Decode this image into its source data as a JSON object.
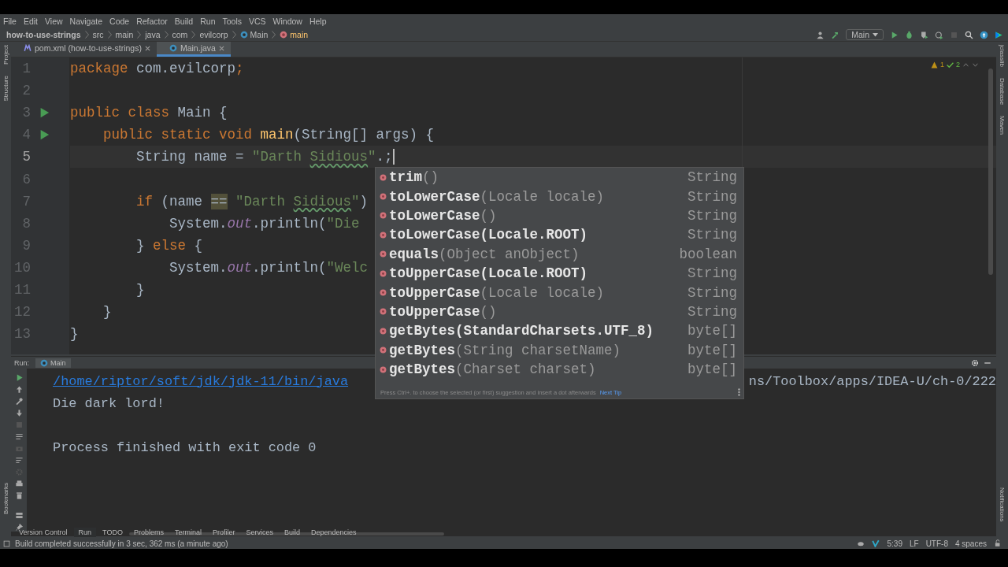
{
  "menu": [
    "File",
    "Edit",
    "View",
    "Navigate",
    "Code",
    "Refactor",
    "Build",
    "Run",
    "Tools",
    "VCS",
    "Window",
    "Help"
  ],
  "breadcrumb": [
    {
      "text": "how-to-use-strings",
      "kind": "project"
    },
    {
      "text": "src",
      "kind": "folder"
    },
    {
      "text": "main",
      "kind": "folder"
    },
    {
      "text": "java",
      "kind": "folder"
    },
    {
      "text": "com",
      "kind": "folder"
    },
    {
      "text": "evilcorp",
      "kind": "folder"
    },
    {
      "text": "Main",
      "kind": "class"
    },
    {
      "text": "main",
      "kind": "method"
    }
  ],
  "toolbar": {
    "run_config": "Main"
  },
  "tabs": [
    {
      "label": "pom.xml (how-to-use-strings)",
      "kind": "maven",
      "selected": false
    },
    {
      "label": "Main.java",
      "kind": "class",
      "selected": true
    }
  ],
  "left_strip": [
    "Project",
    "Structure",
    "Bookmarks"
  ],
  "right_strip": [
    "jclasslib",
    "Database",
    "Maven",
    "Notifications"
  ],
  "inspections": {
    "warnings": "1",
    "typos": "2"
  },
  "code_lines": [
    {
      "number": "1",
      "run_marker": false,
      "current": false,
      "tokens": [
        {
          "text": "package ",
          "kind": "kw"
        },
        {
          "text": "com.evilcorp",
          "kind": "plain"
        },
        {
          "text": ";",
          "kind": "kw"
        }
      ]
    },
    {
      "number": "2",
      "run_marker": false,
      "current": false
    },
    {
      "number": "3",
      "run_marker": true,
      "current": false,
      "tokens": [
        {
          "text": "public class ",
          "kind": "kw"
        },
        {
          "text": "Main {",
          "kind": "plain"
        }
      ]
    },
    {
      "number": "4",
      "run_marker": true,
      "current": false,
      "tokens": [
        {
          "text": "    public static void ",
          "kind": "kw"
        },
        {
          "text": "main",
          "kind": "method"
        },
        {
          "text": "(String[] args) {",
          "kind": "plain"
        }
      ]
    },
    {
      "number": "5",
      "run_marker": false,
      "current": true,
      "tokens": [
        {
          "text": "        String name = ",
          "kind": "plain"
        },
        {
          "text": "\"Darth ",
          "kind": "str"
        },
        {
          "text": "Sidious",
          "kind": "typo"
        },
        {
          "text": "\"",
          "kind": "str"
        },
        {
          "text": ".;",
          "kind": "plain"
        }
      ]
    },
    {
      "number": "6",
      "run_marker": false,
      "current": false
    },
    {
      "number": "7",
      "run_marker": false,
      "current": false,
      "tokens": [
        {
          "text": "        if ",
          "kind": "kw"
        },
        {
          "text": "(name ",
          "kind": "plain"
        },
        {
          "text": "==",
          "kind": "warn"
        },
        {
          "text": " \"Darth ",
          "kind": "str"
        },
        {
          "text": "Sidious",
          "kind": "typo"
        },
        {
          "text": "\"",
          "kind": "str"
        },
        {
          "text": ")",
          "kind": "plain"
        }
      ]
    },
    {
      "number": "8",
      "run_marker": false,
      "current": false,
      "tokens": [
        {
          "text": "            System.",
          "kind": "plain"
        },
        {
          "text": "out",
          "kind": "field"
        },
        {
          "text": ".println(",
          "kind": "plain"
        },
        {
          "text": "\"Die",
          "kind": "str"
        }
      ]
    },
    {
      "number": "9",
      "run_marker": false,
      "current": false,
      "tokens": [
        {
          "text": "        } ",
          "kind": "plain"
        },
        {
          "text": "else ",
          "kind": "kw"
        },
        {
          "text": "{",
          "kind": "plain"
        }
      ]
    },
    {
      "number": "10",
      "run_marker": false,
      "current": false,
      "tokens": [
        {
          "text": "            System.",
          "kind": "plain"
        },
        {
          "text": "out",
          "kind": "field"
        },
        {
          "text": ".println(",
          "kind": "plain"
        },
        {
          "text": "\"Welc",
          "kind": "str"
        }
      ]
    },
    {
      "number": "11",
      "run_marker": false,
      "current": false,
      "tokens": [
        {
          "text": "        }",
          "kind": "plain"
        }
      ]
    },
    {
      "number": "12",
      "run_marker": false,
      "current": false,
      "tokens": [
        {
          "text": "    }",
          "kind": "plain"
        }
      ]
    },
    {
      "number": "13",
      "run_marker": false,
      "current": false,
      "tokens": [
        {
          "text": "}",
          "kind": "plain"
        }
      ]
    }
  ],
  "completion": {
    "items": [
      {
        "name": "trim",
        "params": "()",
        "type": "String"
      },
      {
        "name": "toLowerCase",
        "params": "(Locale locale)",
        "type": "String"
      },
      {
        "name": "toLowerCase",
        "params": "()",
        "type": "String"
      },
      {
        "name": "toLowerCase(Locale.ROOT)",
        "type": "String"
      },
      {
        "name": "equals",
        "params": "(Object anObject)",
        "type": "boolean"
      },
      {
        "name": "toUpperCase(Locale.ROOT)",
        "type": "String"
      },
      {
        "name": "toUpperCase",
        "params": "(Locale locale)",
        "type": "String"
      },
      {
        "name": "toUpperCase",
        "params": "()",
        "type": "String"
      },
      {
        "name": "getBytes(StandardCharsets.UTF_8)",
        "type": "byte[]"
      },
      {
        "name": "getBytes",
        "params": "(String charsetName)",
        "type": "byte[]"
      },
      {
        "name": "getBytes",
        "params": "(Charset charset)",
        "type": "byte[]"
      }
    ],
    "hint": "Press Ctrl+. to choose the selected (or first) suggestion and insert a dot afterwards",
    "tip_link": "Next Tip"
  },
  "run_panel": {
    "label": "Run:",
    "tab": "Main",
    "output": [
      {
        "kind": "command",
        "text": "/home/riptor/soft/jdk/jdk-11/bin/java",
        "tail": "ns/Toolbox/apps/IDEA-U/ch-0/222"
      },
      {
        "kind": "text",
        "text": "Die dark lord!"
      },
      {
        "kind": "blank"
      },
      {
        "kind": "text",
        "text": "Process finished with exit code 0"
      }
    ]
  },
  "tool_windows": [
    {
      "label": "Version Control",
      "selected": false
    },
    {
      "label": "Run",
      "selected": true
    },
    {
      "label": "TODO",
      "selected": false
    },
    {
      "label": "Problems",
      "selected": false
    },
    {
      "label": "Terminal",
      "selected": false
    },
    {
      "label": "Profiler",
      "selected": false
    },
    {
      "label": "Services",
      "selected": false
    },
    {
      "label": "Build",
      "selected": false
    },
    {
      "label": "Dependencies",
      "selected": false
    }
  ],
  "status": {
    "message": "Build completed successfully in 3 sec, 362 ms (a minute ago)",
    "position": "5:39",
    "line_ending": "LF",
    "encoding": "UTF-8",
    "indent": "4 spaces"
  }
}
